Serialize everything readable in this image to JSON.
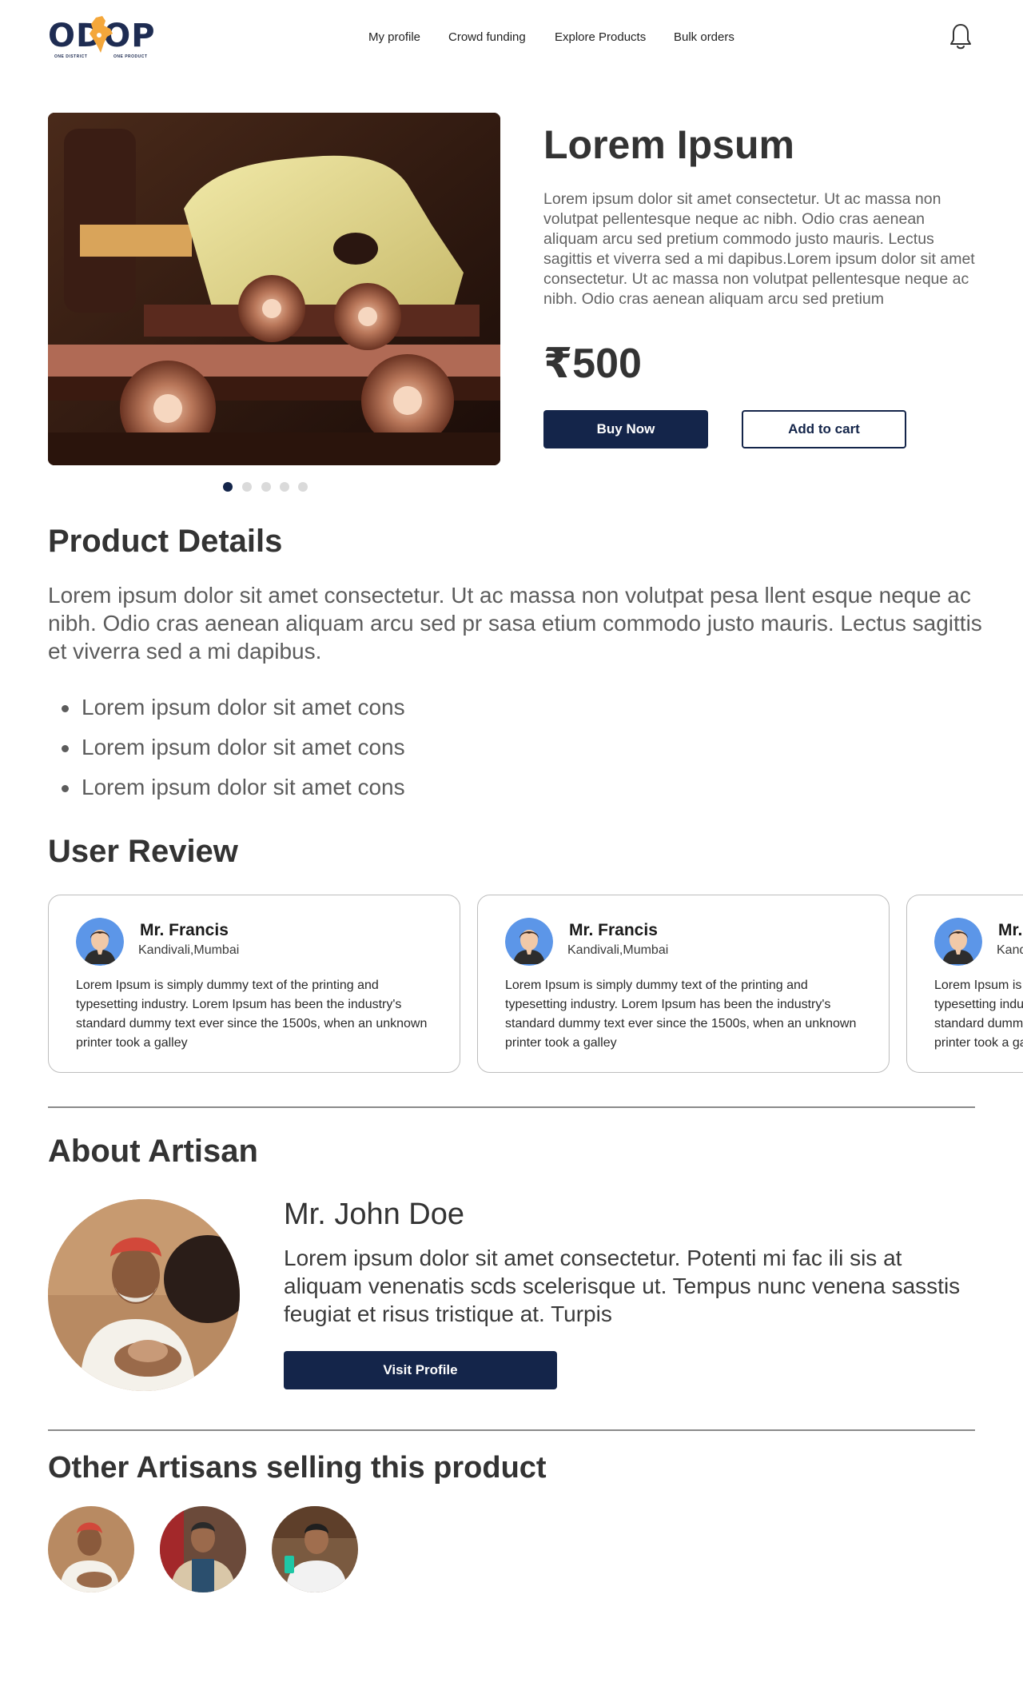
{
  "header": {
    "logo_text": "ODOP",
    "logo_sub_left": "ONE DISTRICT",
    "logo_sub_right": "ONE PRODUCT",
    "nav": [
      "My profile",
      "Crowd funding",
      "Explore Products",
      "Bulk orders"
    ],
    "notification_icon": "bell-icon"
  },
  "product": {
    "title": "Lorem Ipsum",
    "description": "Lorem ipsum dolor sit amet consectetur. Ut ac massa non volutpat pellentesque neque ac nibh. Odio cras aenean aliquam arcu sed pretium commodo justo mauris. Lectus sagittis et viverra sed a mi dapibus.Lorem ipsum dolor sit amet consectetur. Ut ac massa non volutpat pellentesque neque ac nibh. Odio cras aenean aliquam arcu sed pretium",
    "price": "₹500",
    "buy_label": "Buy Now",
    "cart_label": "Add to cart",
    "carousel": {
      "slide_count": 5,
      "active_index": 0
    }
  },
  "details": {
    "title": "Product Details",
    "text": "Lorem ipsum dolor sit amet consectetur. Ut ac massa non volutpat pesa llent esque neque ac nibh. Odio cras aenean aliquam arcu sed pr sasa etium commodo justo mauris. Lectus sagittis et viverra sed a mi dapibus.",
    "bullets": [
      "Lorem ipsum dolor sit amet cons",
      "Lorem ipsum dolor sit amet cons",
      "Lorem ipsum dolor sit amet cons"
    ]
  },
  "reviews": {
    "title": "User Review",
    "items": [
      {
        "name": "Mr. Francis",
        "location": "Kandivali,Mumbai",
        "text": "Lorem Ipsum is simply dummy text of the printing and typesetting industry. Lorem Ipsum has been the industry's standard dummy text ever since the 1500s, when an unknown printer took a galley"
      },
      {
        "name": "Mr. Francis",
        "location": "Kandivali,Mumbai",
        "text": "Lorem Ipsum is simply dummy text of the printing and typesetting industry. Lorem Ipsum has been the industry's standard dummy text ever since the 1500s, when an unknown printer took a galley"
      },
      {
        "name": "Mr. Francis",
        "location": "Kandivali,Mumbai",
        "text": "Lorem Ipsum is simply dummy text of the printing and typesetting industry. Lorem Ipsum has been the industry's standard dummy text ever since the 1500s, when an unknown printer took a galley"
      }
    ]
  },
  "about": {
    "title": "About Artisan",
    "name": "Mr. John Doe",
    "bio": "Lorem ipsum dolor sit amet consectetur. Potenti mi fac ili sis at aliquam venenatis scds scelerisque ut. Tempus nunc venena sasstis feugiat et risus tristique at. Turpis",
    "visit_label": "Visit Profile"
  },
  "others": {
    "title": "Other Artisans selling this product",
    "count": 3
  },
  "colors": {
    "primary": "#14254a",
    "saffron": "#f4a73b",
    "text_dark": "#333333",
    "text_muted": "#5c5c5c"
  }
}
